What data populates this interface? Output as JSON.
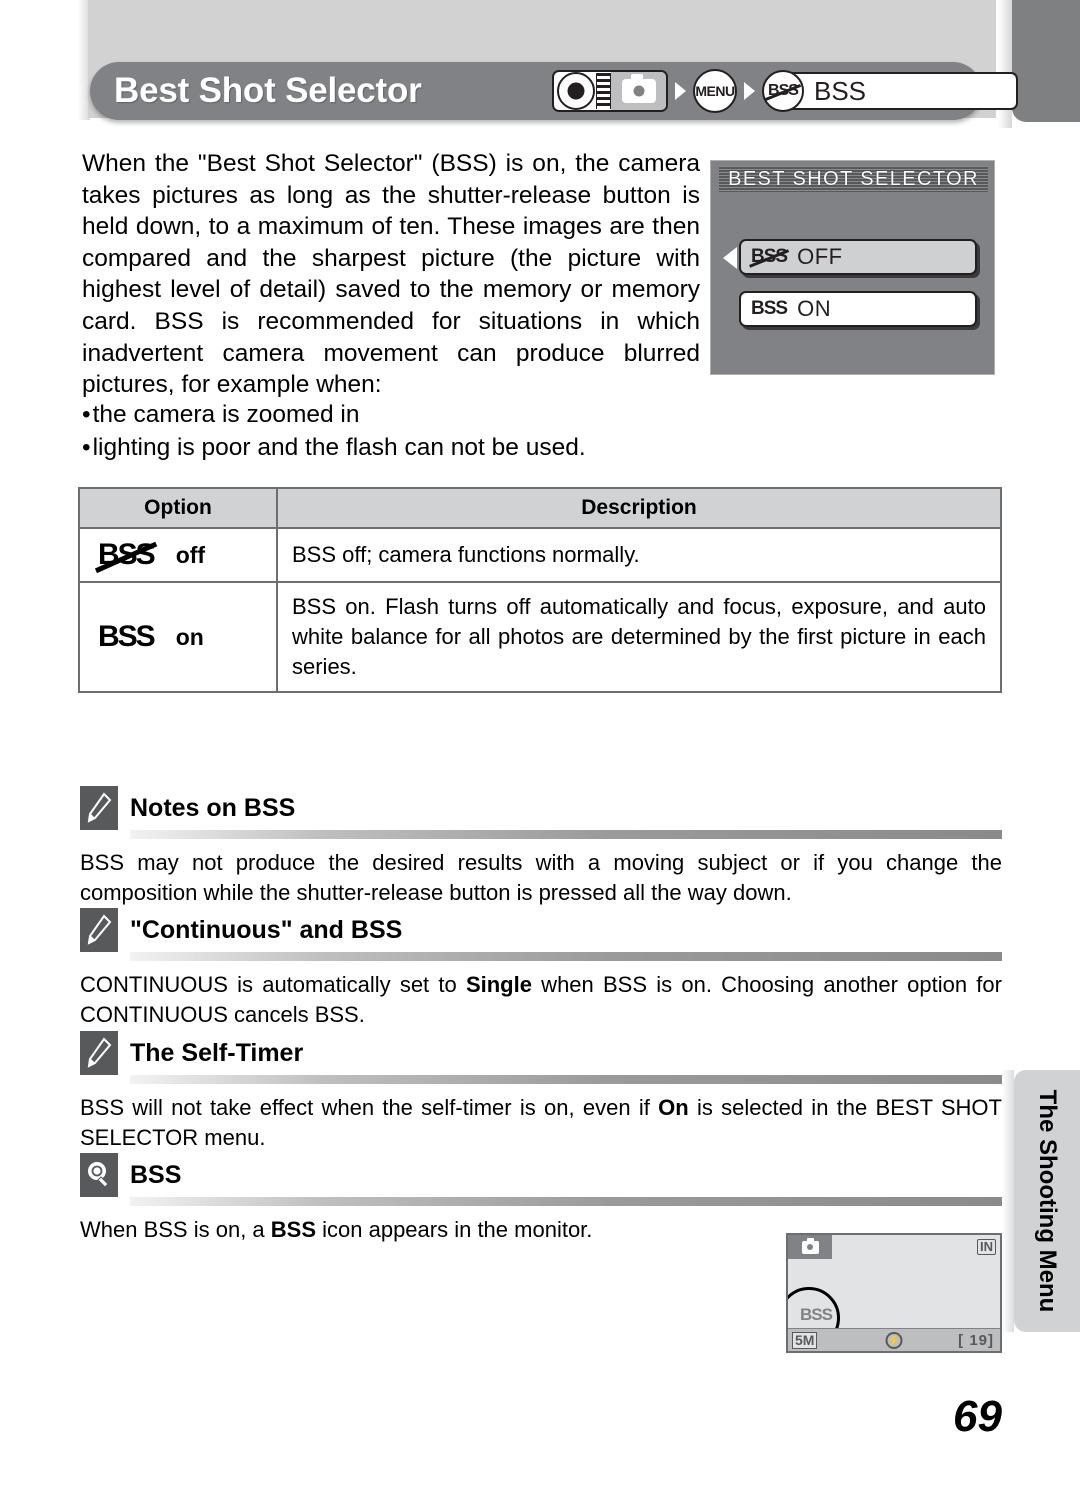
{
  "header": {
    "title": "Best Shot Selector",
    "mode_icon": "camera-mode-icon",
    "menu_label": "MENU",
    "bss_icon_label": "BSS",
    "bss_field_label": "BSS"
  },
  "body": {
    "paragraph": "When the \"Best Shot Selector\" (BSS) is on, the camera takes pictures as long as the shutter-release button is held down, to a maximum of ten. These images are then compared and the sharpest picture (the picture with highest level of detail) saved to the memory or memory card. BSS is recommended for situations in which inadvertent camera movement can produce blurred pictures, for example when:",
    "bullets": [
      "the camera is zoomed in",
      "lighting is poor and the flash can not be used."
    ]
  },
  "lcd": {
    "title": "BEST SHOT SELECTOR",
    "rows": [
      {
        "icon": "BSS",
        "label": "OFF",
        "selected": true
      },
      {
        "icon": "BSS",
        "label": "ON",
        "selected": false
      }
    ]
  },
  "table": {
    "headers": [
      "Option",
      "Description"
    ],
    "rows": [
      {
        "icon": "BSS",
        "icon_state": "struck-through",
        "option": "off",
        "description": "BSS off; camera functions normally."
      },
      {
        "icon": "BSS",
        "icon_state": "plain",
        "option": "on",
        "description": "BSS on. Flash turns off automatically and focus, exposure, and auto white balance for all photos are determined by the first picture in each series."
      }
    ]
  },
  "notes": [
    {
      "icon": "pencil-icon",
      "title": "Notes on BSS",
      "body_parts": [
        {
          "text": "BSS may not produce the desired results with a moving subject or if you change the composition while the shutter-release button is pressed all the way down.",
          "bold": false
        }
      ]
    },
    {
      "icon": "pencil-icon",
      "title": "\"Continuous\" and BSS",
      "body_parts": [
        {
          "text": "CONTINUOUS is automatically set to ",
          "bold": false
        },
        {
          "text": "Single",
          "bold": true
        },
        {
          "text": " when BSS is on. Choosing another option for CONTINUOUS cancels BSS.",
          "bold": false
        }
      ]
    },
    {
      "icon": "pencil-icon",
      "title": "The Self-Timer",
      "body_parts": [
        {
          "text": "BSS will not take effect when the self-timer is on, even if ",
          "bold": false
        },
        {
          "text": "On",
          "bold": true
        },
        {
          "text": " is selected in the BEST SHOT SELECTOR menu.",
          "bold": false
        }
      ]
    },
    {
      "icon": "lightbulb-icon",
      "title": "BSS",
      "body_parts": [
        {
          "text": "When BSS is on, a ",
          "bold": false
        },
        {
          "text": "BSS",
          "bold": true
        },
        {
          "text": " icon appears in the monitor.",
          "bold": false
        }
      ]
    }
  ],
  "monitor": {
    "mode_icon": "camera-icon",
    "memory_icon": "IN",
    "bss_indicator": "BSS",
    "image_size": "5M",
    "flash_icon": "flash-off-icon",
    "exposures_remaining": "[ 19]"
  },
  "side_tab": {
    "label": "The Shooting Menu"
  },
  "page_number": "69",
  "colors": {
    "header_bar": "#808285",
    "panel": "#d2d2d2",
    "lcd_bg": "#808285",
    "note_icon_bg": "#58595b",
    "table_header": "#d1d2d4"
  }
}
